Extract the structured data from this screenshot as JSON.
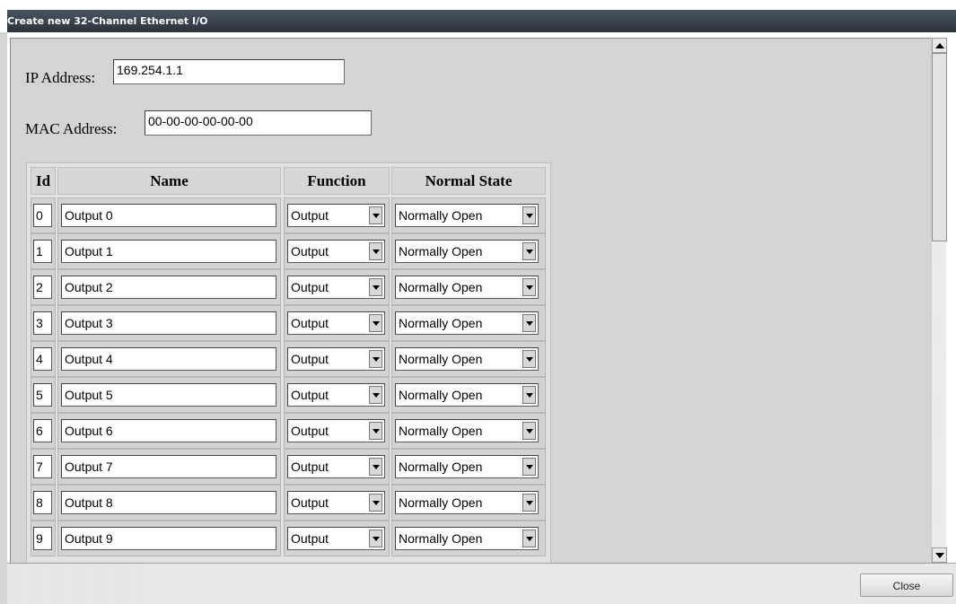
{
  "window": {
    "title": "Create new 32-Channel Ethernet I/O"
  },
  "form": {
    "ip_label": "IP Address:",
    "ip_value": "169.254.1.1",
    "mac_label": "MAC Address:",
    "mac_value": "00-00-00-00-00-00"
  },
  "table": {
    "headers": [
      "Id",
      "Name",
      "Function",
      "Normal State"
    ],
    "rows": [
      {
        "id": "0",
        "name": "Output 0",
        "function": "Output",
        "state": "Normally Open"
      },
      {
        "id": "1",
        "name": "Output 1",
        "function": "Output",
        "state": "Normally Open"
      },
      {
        "id": "2",
        "name": "Output 2",
        "function": "Output",
        "state": "Normally Open"
      },
      {
        "id": "3",
        "name": "Output 3",
        "function": "Output",
        "state": "Normally Open"
      },
      {
        "id": "4",
        "name": "Output 4",
        "function": "Output",
        "state": "Normally Open"
      },
      {
        "id": "5",
        "name": "Output 5",
        "function": "Output",
        "state": "Normally Open"
      },
      {
        "id": "6",
        "name": "Output 6",
        "function": "Output",
        "state": "Normally Open"
      },
      {
        "id": "7",
        "name": "Output 7",
        "function": "Output",
        "state": "Normally Open"
      },
      {
        "id": "8",
        "name": "Output 8",
        "function": "Output",
        "state": "Normally Open"
      },
      {
        "id": "9",
        "name": "Output 9",
        "function": "Output",
        "state": "Normally Open"
      }
    ]
  },
  "footer": {
    "close_label": "Close"
  }
}
